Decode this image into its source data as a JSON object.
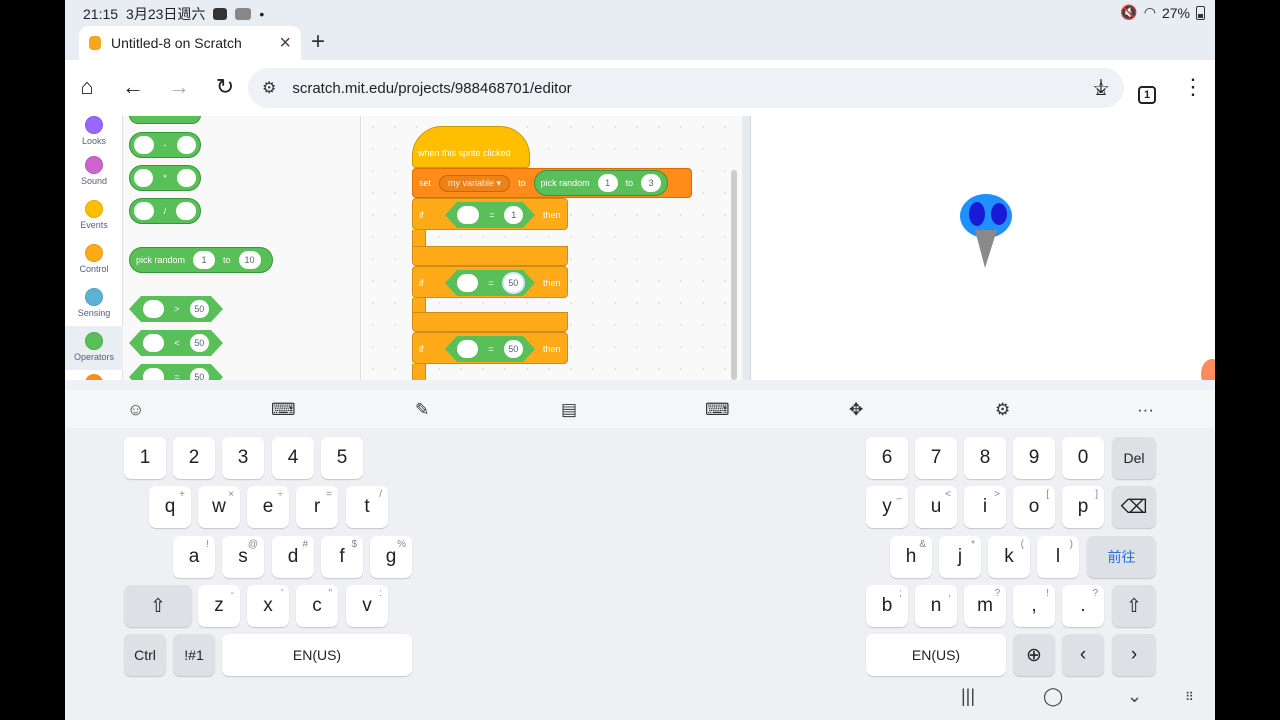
{
  "status": {
    "time": "21:15",
    "date": "3月23日週六",
    "battery": "27%"
  },
  "tab": {
    "title": "Untitled-8 on Scratch",
    "close": "×",
    "new_tab": "+"
  },
  "toolbar": {
    "url": "scratch.mit.edu/projects/988468701/editor",
    "tab_count": "1",
    "home": "⌂",
    "back": "←",
    "forward": "→",
    "reload": "↻",
    "star": "☆",
    "download": "⤓",
    "menu": "⋮"
  },
  "categories": [
    {
      "label": "Looks",
      "color": "#9966ff"
    },
    {
      "label": "Sound",
      "color": "#cf63cf"
    },
    {
      "label": "Events",
      "color": "#ffbf00"
    },
    {
      "label": "Control",
      "color": "#ffab19"
    },
    {
      "label": "Sensing",
      "color": "#5cb1d6"
    },
    {
      "label": "Operators",
      "color": "#59c059"
    }
  ],
  "palette": {
    "minus": "-",
    "times": "*",
    "divide": "/",
    "random_label": "pick random",
    "random_from": "1",
    "random_to_word": "to",
    "random_to": "10",
    "gt": ">",
    "lt": "<",
    "eq": "=",
    "cmp_value": "50"
  },
  "script": {
    "hat": "when this sprite clicked",
    "set": "set",
    "variable": "my variable",
    "to": "to",
    "random_label": "pick random",
    "random_from": "1",
    "random_to_word": "to",
    "random_to": "3",
    "if": "if",
    "then": "then",
    "eq": "=",
    "if1_value": "1",
    "if2_value": "50",
    "if3_value": "50"
  },
  "keyboard": {
    "row1_left": [
      "1",
      "2",
      "3",
      "4",
      "5"
    ],
    "row1_right": [
      "6",
      "7",
      "8",
      "9",
      "0"
    ],
    "del": "Del",
    "row2_left": [
      [
        "q",
        "+"
      ],
      [
        "w",
        "×"
      ],
      [
        "e",
        "÷"
      ],
      [
        "r",
        "="
      ],
      [
        "t",
        "/"
      ]
    ],
    "row2_right": [
      [
        "y",
        "_"
      ],
      [
        "u",
        "<"
      ],
      [
        "i",
        ">"
      ],
      [
        "o",
        "["
      ],
      [
        "p",
        "]"
      ]
    ],
    "row3_left": [
      [
        "a",
        "!"
      ],
      [
        "s",
        "@"
      ],
      [
        "d",
        "#"
      ],
      [
        "f",
        "$"
      ],
      [
        "g",
        "%"
      ]
    ],
    "row3_right": [
      [
        "h",
        "&"
      ],
      [
        "j",
        "*"
      ],
      [
        "k",
        "("
      ],
      [
        "l",
        ")"
      ]
    ],
    "go": "前往",
    "row4_left": [
      [
        "z",
        "-"
      ],
      [
        "x",
        "'"
      ],
      [
        "c",
        "\""
      ],
      [
        "v",
        ":"
      ]
    ],
    "row4_right": [
      [
        "b",
        ";"
      ],
      [
        "n",
        ","
      ],
      [
        "m",
        "?"
      ],
      [
        ",",
        "!"
      ],
      [
        ".",
        "?"
      ]
    ],
    "ctrl": "Ctrl",
    "sym": "!#1",
    "space_left": "EN(US)",
    "space_right": "EN(US)",
    "shift": "⇧",
    "backspace": "⌫",
    "globe": "⊕",
    "left": "‹",
    "right": "›"
  },
  "navbar": {
    "recents": "|||",
    "home": "◯",
    "back": "⌄"
  }
}
